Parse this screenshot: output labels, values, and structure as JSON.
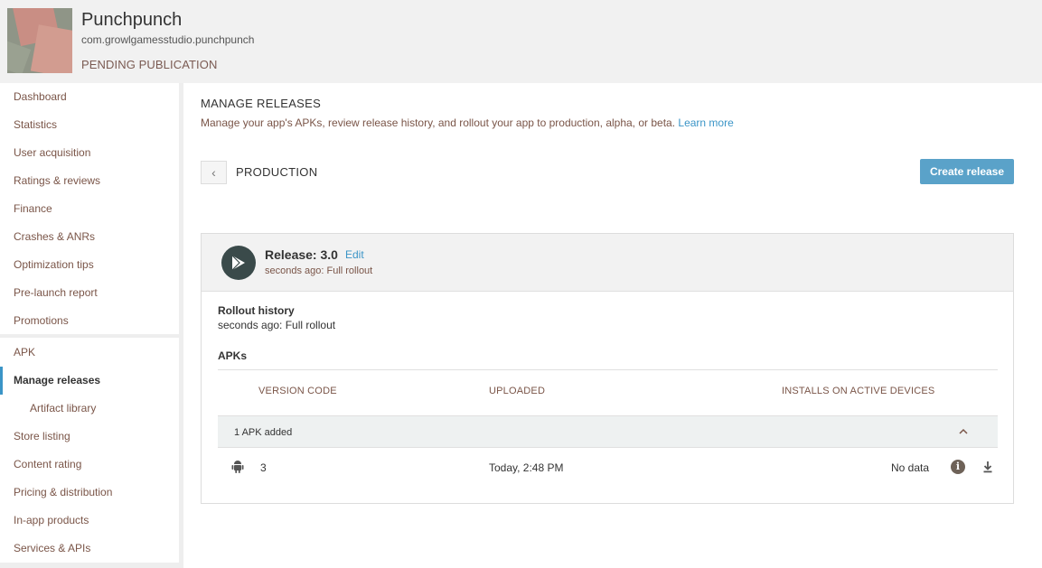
{
  "header": {
    "app_name": "Punchpunch",
    "package": "com.growlgamesstudio.punchpunch",
    "status": "PENDING PUBLICATION"
  },
  "sidebar": {
    "items": [
      {
        "label": "Dashboard"
      },
      {
        "label": "Statistics"
      },
      {
        "label": "User acquisition"
      },
      {
        "label": "Ratings & reviews"
      },
      {
        "label": "Finance"
      },
      {
        "label": "Crashes & ANRs"
      },
      {
        "label": "Optimization tips"
      },
      {
        "label": "Pre-launch report"
      },
      {
        "label": "Promotions"
      },
      {
        "label": "APK"
      },
      {
        "label": "Manage releases"
      },
      {
        "label": "Artifact library"
      },
      {
        "label": "Store listing"
      },
      {
        "label": "Content rating"
      },
      {
        "label": "Pricing & distribution"
      },
      {
        "label": "In-app products"
      },
      {
        "label": "Services & APIs"
      }
    ],
    "active": "Manage releases"
  },
  "main": {
    "title": "MANAGE RELEASES",
    "description": "Manage your app's APKs, review release history, and rollout your app to production, alpha, or beta.",
    "learn_more": "Learn more",
    "back_glyph": "‹",
    "section": "PRODUCTION",
    "create_button": "Create release",
    "release": {
      "name": "Release: 3.0",
      "edit": "Edit",
      "subtitle": "seconds ago: Full rollout",
      "rollout_history_title": "Rollout history",
      "rollout_history_value": "seconds ago: Full rollout",
      "apks_title": "APKs",
      "columns": [
        "VERSION CODE",
        "UPLOADED",
        "INSTALLS ON ACTIVE DEVICES"
      ],
      "group_label": "1 APK added",
      "rows": [
        {
          "version_code": "3",
          "uploaded": "Today, 2:48 PM",
          "installs": "No data"
        }
      ]
    }
  },
  "icons": {
    "back": "chevron-left-icon",
    "release": "play-arrow-icon",
    "collapse": "chevron-up-icon",
    "platform": "android-icon",
    "info": "info-icon",
    "download": "download-icon"
  },
  "colors": {
    "accent": "#3b95c7",
    "button": "#5aa2c9",
    "header_bg": "#f1f1f1"
  }
}
